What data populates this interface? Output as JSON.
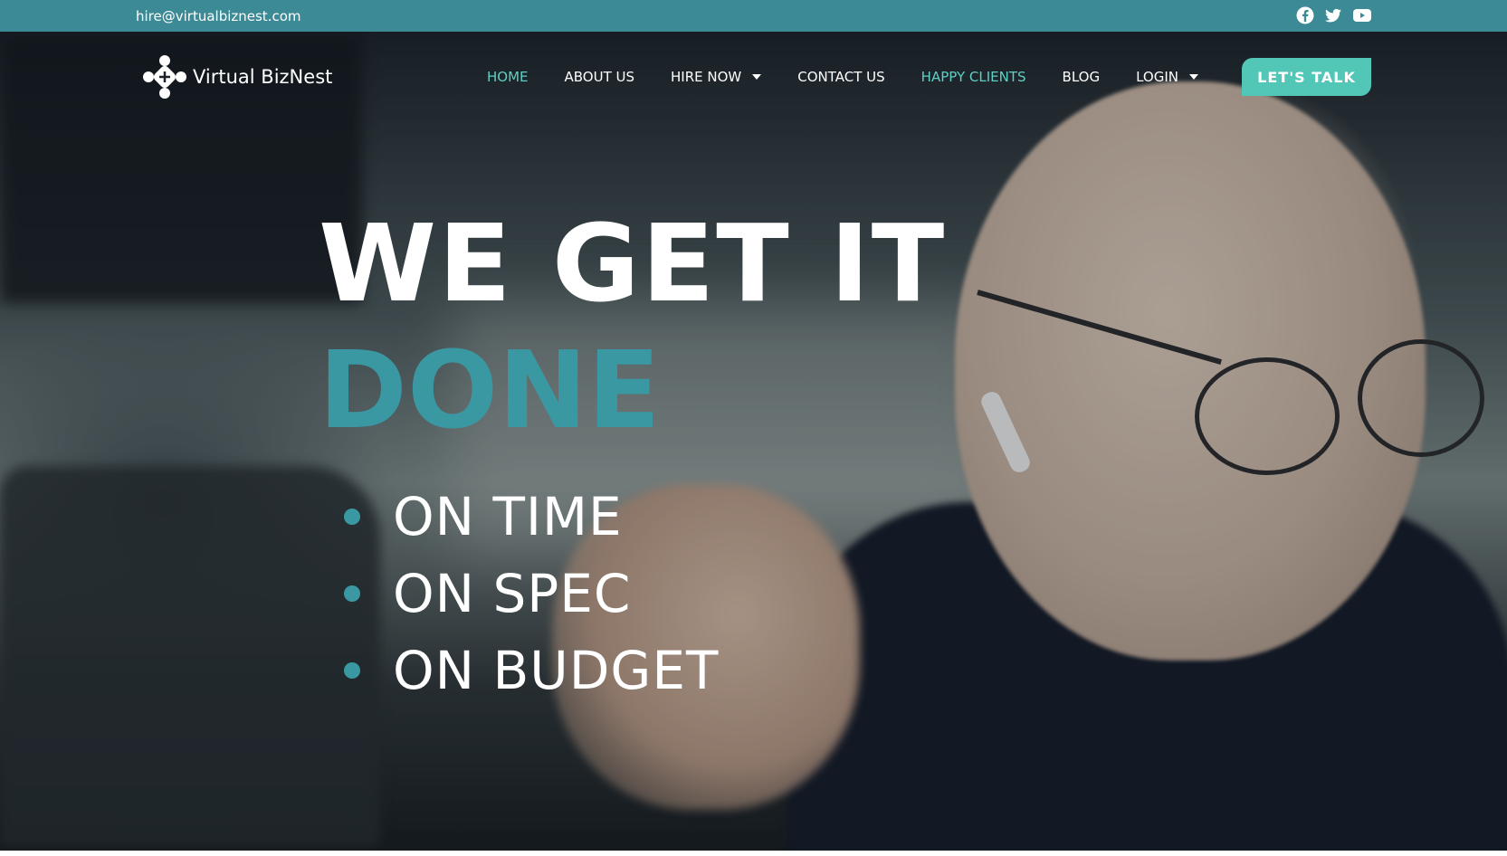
{
  "topbar": {
    "email": "hire@virtualbiznest.com",
    "social": [
      "facebook-icon",
      "twitter-icon",
      "youtube-icon"
    ]
  },
  "brand": {
    "name": "Virtual BizNest"
  },
  "nav": {
    "items": [
      {
        "label": "HOME",
        "active": true,
        "dropdown": false
      },
      {
        "label": "ABOUT US",
        "active": false,
        "dropdown": false
      },
      {
        "label": "HIRE NOW",
        "active": false,
        "dropdown": true
      },
      {
        "label": "CONTACT US",
        "active": false,
        "dropdown": false
      },
      {
        "label": "HAPPY CLIENTS",
        "active": true,
        "dropdown": false
      },
      {
        "label": "BLOG",
        "active": false,
        "dropdown": false
      },
      {
        "label": "LOGIN",
        "active": false,
        "dropdown": true
      }
    ],
    "cta_label": "LET'S TALK"
  },
  "hero": {
    "line1": "WE GET IT",
    "line2": "DONE",
    "bullets": [
      "ON TIME",
      "ON SPEC",
      "ON BUDGET"
    ]
  },
  "colors": {
    "topbar": "#3c8a95",
    "accent": "#52c7b8",
    "active_link": "#5fd0c3",
    "headline_accent": "#3a98a3"
  }
}
